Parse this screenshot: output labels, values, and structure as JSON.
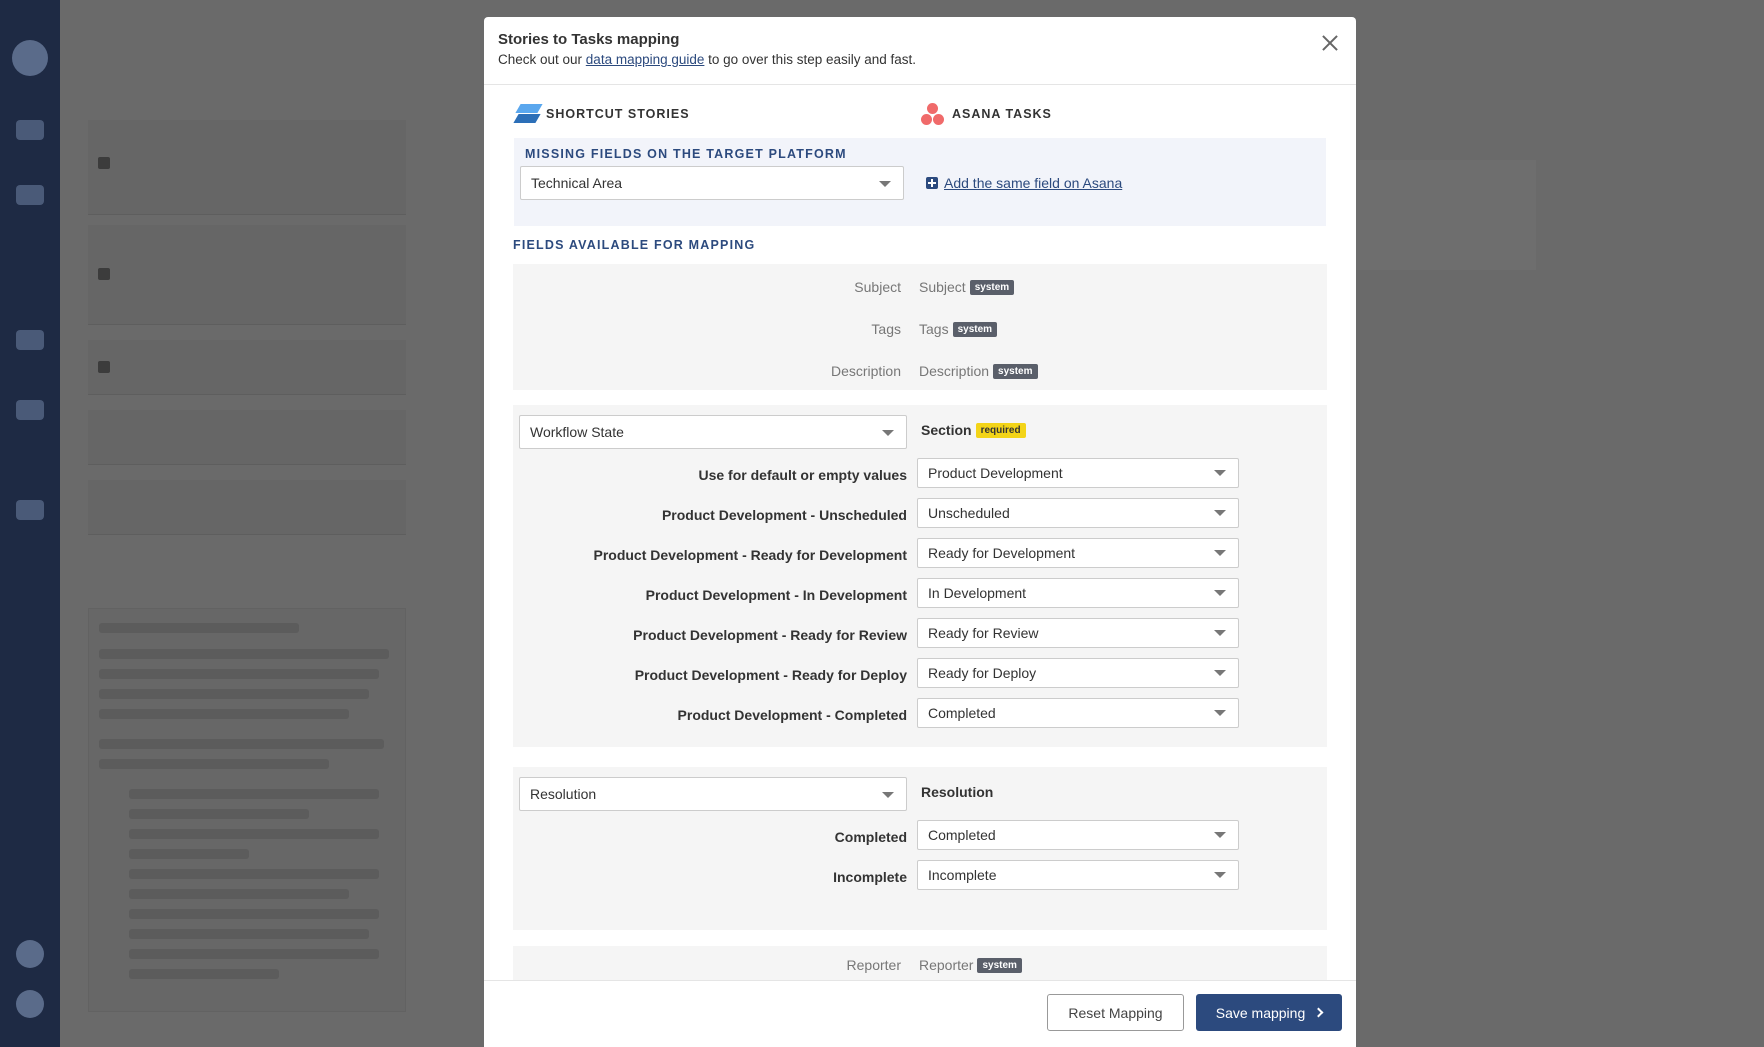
{
  "modal": {
    "title": "Stories to Tasks mapping",
    "subtitle_before": "Check out our ",
    "subtitle_link": "data mapping guide",
    "subtitle_after": " to go over this step easily and fast."
  },
  "source_platform": {
    "name": "SHORTCUT STORIES",
    "icon": "shortcut-logo-icon"
  },
  "target_platform": {
    "name": "ASANA TASKS",
    "icon": "asana-logo-icon"
  },
  "missing_fields": {
    "heading": "MISSING FIELDS ON THE TARGET PLATFORM",
    "selected": "Technical Area",
    "add_link": "Add the same field on Asana"
  },
  "available": {
    "heading": "FIELDS AVAILABLE FOR MAPPING",
    "system_rows": [
      {
        "source": "Subject",
        "target": "Subject",
        "badge": "system"
      },
      {
        "source": "Tags",
        "target": "Tags",
        "badge": "system"
      },
      {
        "source": "Description",
        "target": "Description",
        "badge": "system"
      }
    ]
  },
  "workflow": {
    "source_field": "Workflow State",
    "target_field": "Section",
    "badge": "required",
    "rows": [
      {
        "label": "Use for default or empty values",
        "value": "Product Development"
      },
      {
        "label": "Product Development - Unscheduled",
        "value": "Unscheduled"
      },
      {
        "label": "Product Development - Ready for Development",
        "value": "Ready for Development"
      },
      {
        "label": "Product Development - In Development",
        "value": "In Development"
      },
      {
        "label": "Product Development - Ready for Review",
        "value": "Ready for Review"
      },
      {
        "label": "Product Development - Ready for Deploy",
        "value": "Ready for Deploy"
      },
      {
        "label": "Product Development - Completed",
        "value": "Completed"
      }
    ]
  },
  "resolution": {
    "source_field": "Resolution",
    "target_field": "Resolution",
    "rows": [
      {
        "label": "Completed",
        "value": "Completed"
      },
      {
        "label": "Incomplete",
        "value": "Incomplete"
      }
    ]
  },
  "reporter": {
    "source": "Reporter",
    "target": "Reporter",
    "badge": "system"
  },
  "footer": {
    "reset": "Reset Mapping",
    "save": "Save mapping"
  }
}
